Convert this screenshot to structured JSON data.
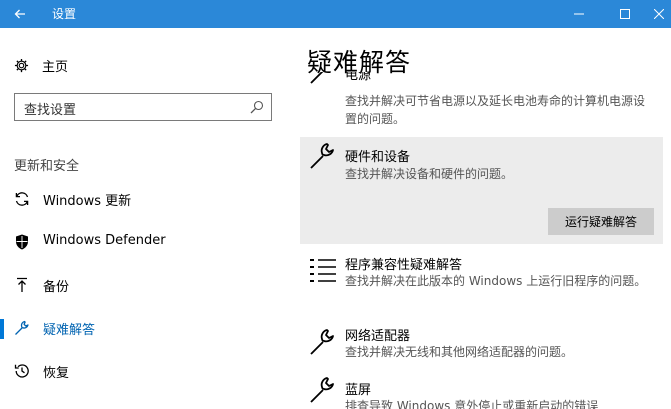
{
  "window": {
    "title": "设置",
    "back_icon": "back-arrow-icon",
    "minimize_glyph": "—",
    "maximize_glyph": "☐",
    "close_glyph": "✕",
    "titlebar_color": "#2b88d8"
  },
  "nav": {
    "home_label": "主页",
    "search_placeholder": "查找设置",
    "section_heading": "更新和安全",
    "items": [
      {
        "label": "Windows 更新",
        "icon": "refresh-icon"
      },
      {
        "label": "Windows Defender",
        "icon": "shield-icon"
      },
      {
        "label": "备份",
        "icon": "upload-arrow-icon"
      },
      {
        "label": "疑难解答",
        "icon": "wrench-icon",
        "active": true
      },
      {
        "label": "恢复",
        "icon": "history-icon"
      }
    ],
    "accent_color": "#0078d7"
  },
  "main": {
    "title": "疑难解答",
    "cut_off_top_name": "电源",
    "items": [
      {
        "name": "",
        "desc": "查找并解决可节省电源以及延长电池寿命的计算机电源设置的问题。",
        "icon": "wrench-icon"
      },
      {
        "name": "硬件和设备",
        "desc": "查找并解决设备和硬件的问题。",
        "icon": "wrench-icon",
        "selected": true,
        "button_label": "运行疑难解答"
      },
      {
        "name": "程序兼容性疑难解答",
        "desc": "查找并解决在此版本的 Windows 上运行旧程序的问题。",
        "icon": "list-icon"
      },
      {
        "name": "网络适配器",
        "desc": "查找并解决无线和其他网络适配器的问题。",
        "icon": "wrench-icon"
      },
      {
        "name": "蓝屏",
        "desc": "排查导致 Windows 意外停止或重新启动的错误",
        "icon": "wrench-icon"
      }
    ]
  }
}
